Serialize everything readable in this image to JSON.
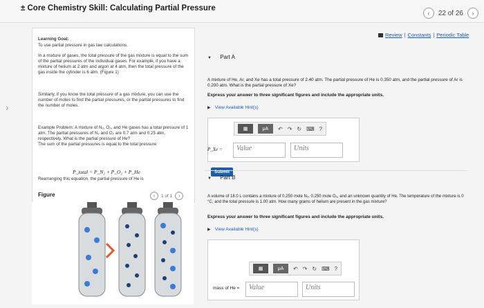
{
  "window": {
    "title": "± Core Chemistry Skill: Calculating Partial Pressure"
  },
  "pager": {
    "text": "22 of 26"
  },
  "top_links": {
    "review": "Review",
    "constants": "Constants",
    "periodic": "Periodic Table",
    "sep": "|"
  },
  "goal": {
    "heading": "Learning Goal:",
    "subtitle": "To use partial pressure in gas law calculations.",
    "para1": "In a mixture of gases, the total pressure of the gas mixture is equal to the sum of the partial pressures of the individual gases. For example, if you have a mixture of helium at 2 atm and argon at 4 atm, then the total pressure of the gas inside the cylinder is 6 atm. (Figure 1)",
    "para2": "Similarly, if you know the total pressure of a gas mixture, you can use the number of moles to find the partial pressures, or the partial pressures to find the number of moles."
  },
  "example": {
    "line1": "Example Problem: A mixture of N₂, O₂, and He gases has a total pressure of 1 atm. The partial pressures of N₂ and O₂ are 0.7 atm and 0.25 atm, respectively. What is the partial pressure of He?",
    "line2": "The sum of the partial pressures is equal to the total pressure:",
    "formula": "P_total = P_N₂ + P_O₂ + P_He",
    "line3": "Rearranging this equation, the partial pressure of He is"
  },
  "figure": {
    "label": "Figure",
    "pager": "1 of 1"
  },
  "partA": {
    "label": "Part A",
    "question": "A mixture of He, Ar, and Xe has a total pressure of 2.40 atm. The partial pressure of He is 0.350 atm, and the partial pressure of Ar is 0.200 atm. What is the partial pressure of Xe?",
    "instruction": "Express your answer to three significant figures and include the appropriate units.",
    "hints": "View Available Hint(s)",
    "var_label": "P_Xe =",
    "value_placeholder": "Value",
    "units_placeholder": "Units",
    "submit": "Submit"
  },
  "partB": {
    "label": "Part B",
    "question": "A volume of 18.0 L contains a mixture of 0.250 mole N₂, 0.250 mole O₂, and an unknown quantity of He. The temperature of the mixture is 0 °C, and the total pressure is 1.00 atm. How many grams of helium are present in the gas mixture?",
    "instruction": "Express your answer to three significant figures and include the appropriate units.",
    "hints": "View Available Hint(s)",
    "var_label": "mass of He =",
    "value_placeholder": "Value",
    "units_placeholder": "Units"
  },
  "toolbar": {
    "templates": "▦",
    "mu": "μA",
    "undo": "↶",
    "redo": "↷",
    "reset": "↻",
    "keyboard": "⌨",
    "help": "?"
  },
  "colors": {
    "accent": "#1a5fb4",
    "submit": "#1a5fa8",
    "cylinder": "#6b6f75",
    "gas_blue": "#3a7bd5"
  }
}
